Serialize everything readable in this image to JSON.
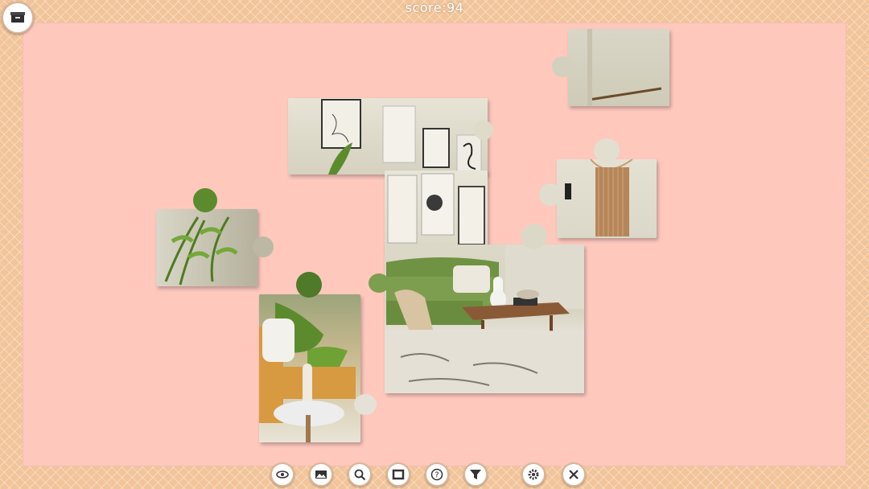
{
  "hud": {
    "score_text": "score:94"
  },
  "toolbar": {
    "buttons": [
      {
        "icon": "eye-icon"
      },
      {
        "icon": "image-preview-icon"
      },
      {
        "icon": "magnifier-icon"
      },
      {
        "icon": "frame-icon"
      },
      {
        "icon": "help-icon"
      },
      {
        "icon": "filter-icon"
      },
      {
        "icon": "gear-icon"
      },
      {
        "icon": "close-icon"
      }
    ]
  },
  "colors": {
    "frame": "#f2c49a",
    "board": "#fec8bd",
    "wall": "#e9e6da",
    "sofa": "#7d9e4e",
    "plant": "#5c8b2e",
    "wood": "#8a5a37",
    "chair": "#d79a41",
    "rug": "#e4e0d6"
  }
}
